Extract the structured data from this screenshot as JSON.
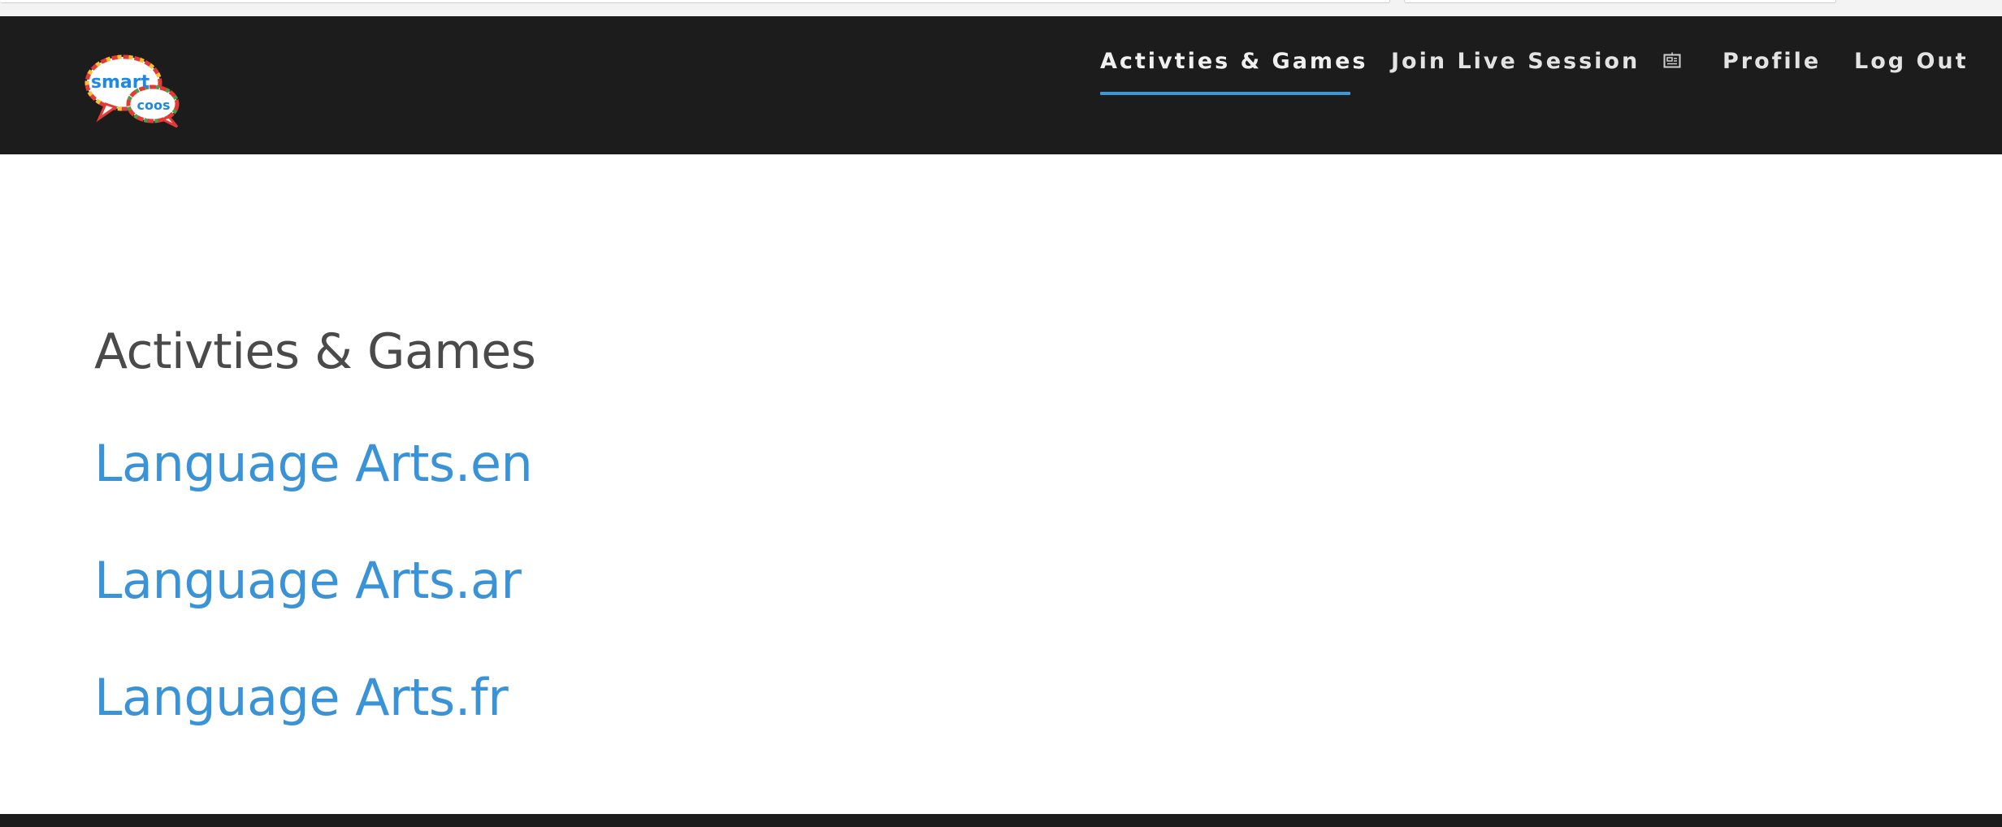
{
  "logo": {
    "line1": "smart",
    "line2": "coos",
    "colors": {
      "bubble_text": "#1e88e5",
      "border_red": "#e53935",
      "border_yellow": "#fbc02d"
    }
  },
  "nav": {
    "items": [
      {
        "label": "Activties & Games",
        "active": true
      },
      {
        "label": "Join Live Session",
        "icon": "live-session-icon"
      },
      {
        "label": "Profile"
      },
      {
        "label": "Log Out"
      }
    ]
  },
  "main": {
    "heading": "Activties & Games",
    "links": [
      {
        "label": "Language Arts.en"
      },
      {
        "label": "Language Arts.ar"
      },
      {
        "label": "Language Arts.fr"
      }
    ]
  },
  "colors": {
    "navbar_bg": "#1c1c1c",
    "accent": "#3a9ad9",
    "link": "#3a93d6",
    "heading": "#4a4a4a"
  }
}
